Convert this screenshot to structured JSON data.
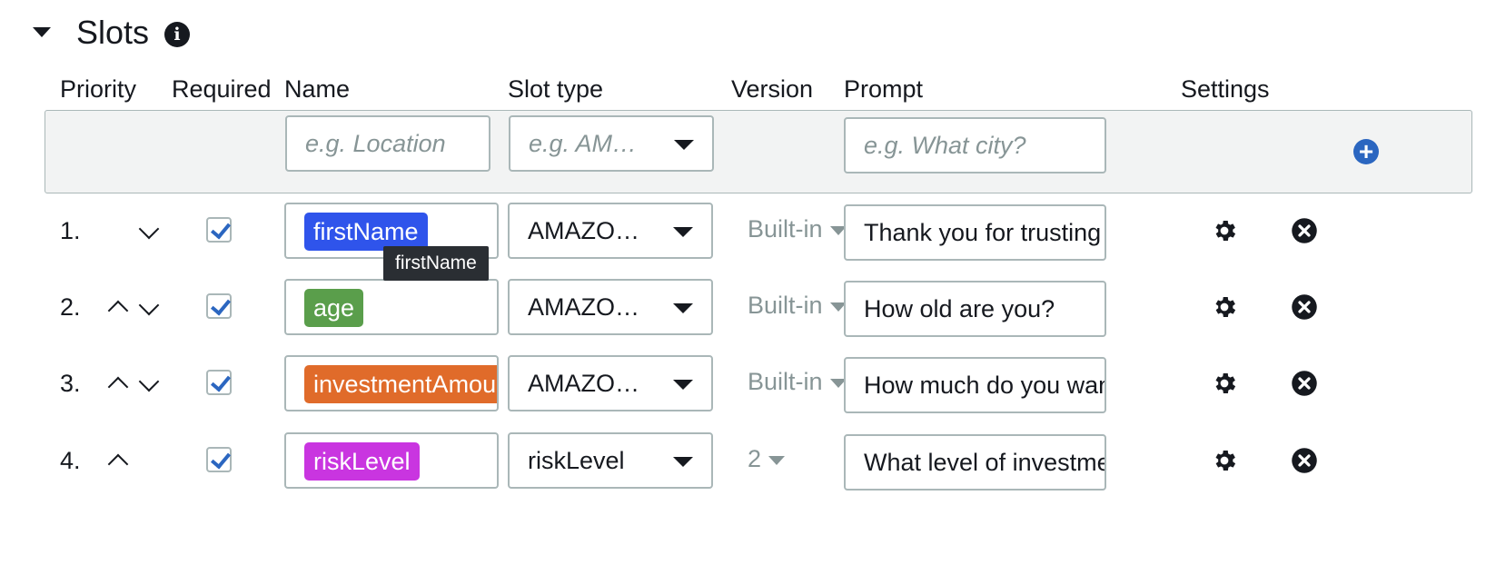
{
  "section": {
    "title": "Slots",
    "info_icon": "i"
  },
  "columns": {
    "priority": "Priority",
    "required": "Required",
    "name": "Name",
    "slot_type": "Slot type",
    "version": "Version",
    "prompt": "Prompt",
    "settings": "Settings"
  },
  "new_slot": {
    "name_placeholder": "e.g. Location",
    "slot_type_placeholder": "e.g. AMAZON.US_CITY",
    "prompt_placeholder": "e.g. What city?",
    "add_icon": "plus-circle",
    "add_glyph": "+"
  },
  "slots": [
    {
      "priority": "1.",
      "required": true,
      "name": "firstName",
      "chip_color": "#2f54eb",
      "slot_type": "AMAZON.US_FIRST_NAME",
      "version": "Built-in",
      "prompt": "Thank you for trusting"
    },
    {
      "priority": "2.",
      "required": true,
      "name": "age",
      "chip_color": "#5a9e4b",
      "slot_type": "AMAZON.NUMBER",
      "version": "Built-in",
      "prompt": "How old are you?"
    },
    {
      "priority": "3.",
      "required": true,
      "name": "investmentAmount",
      "chip_color": "#e06b2a",
      "slot_type": "AMAZON.NUMBER",
      "version": "Built-in",
      "prompt": "How much do you wan"
    },
    {
      "priority": "4.",
      "required": true,
      "name": "riskLevel",
      "chip_color": "#c935e0",
      "slot_type": "riskLevel",
      "version": "2",
      "prompt": "What level of investme"
    }
  ],
  "tooltip": {
    "text": "firstName"
  },
  "colors": {
    "accent": "#2b66c0",
    "border": "#aab7b8",
    "header_bg": "#f2f3f3"
  }
}
